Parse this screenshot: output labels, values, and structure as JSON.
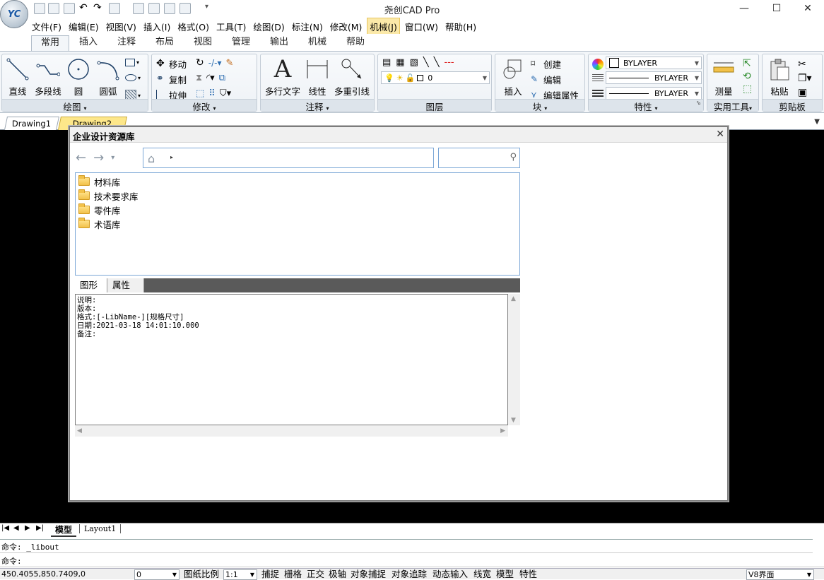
{
  "app": {
    "title": "尧创CAD Pro",
    "logo_text": "YC"
  },
  "menus": [
    "文件(F)",
    "编辑(E)",
    "视图(V)",
    "插入(I)",
    "格式(O)",
    "工具(T)",
    "绘图(D)",
    "标注(N)",
    "修改(M)",
    "机械(J)",
    "窗口(W)",
    "帮助(H)"
  ],
  "ribbon_tabs": [
    "常用",
    "插入",
    "注释",
    "布局",
    "视图",
    "管理",
    "输出",
    "机械",
    "帮助"
  ],
  "ribbon": {
    "draw": {
      "label": "绘图",
      "line": "直线",
      "polyline": "多段线",
      "circle": "圆",
      "arc": "圆弧"
    },
    "modify": {
      "label": "修改",
      "move": "移动",
      "copy": "复制",
      "stretch": "拉伸"
    },
    "annotate": {
      "label": "注释",
      "mtext": "多行文字",
      "linear": "线性",
      "mleader": "多重引线"
    },
    "layer": {
      "label": "图层",
      "current": "0"
    },
    "block": {
      "label": "块",
      "insert": "插入",
      "create": "创建",
      "edit": "编辑",
      "edit_attr": "编辑属性"
    },
    "props": {
      "label": "特性",
      "color": "BYLAYER",
      "linetype": "BYLAYER",
      "lineweight": "BYLAYER"
    },
    "utils": {
      "label": "实用工具",
      "measure": "测量"
    },
    "clipboard": {
      "label": "剪贴板",
      "paste": "粘贴"
    }
  },
  "doc_tabs": [
    "Drawing1",
    "Drawing2"
  ],
  "dialog": {
    "title": "企业设计资源库",
    "tree": [
      "材料库",
      "技术要求库",
      "零件库",
      "术语库"
    ],
    "tabs": [
      "图形",
      "属性"
    ],
    "info": [
      "说明:",
      "版本:",
      "格式:[-LibName-][规格尺寸]",
      "日期:2021-03-18 14:01:10.000",
      "备注:"
    ]
  },
  "layout_tabs": [
    "模型",
    "Layout1"
  ],
  "command": {
    "line1": "命令: _libout",
    "line2": "命令:"
  },
  "status": {
    "coords": "450.4055,850.7409,0",
    "layer_value": "0",
    "paper_scale_label": "图纸比例",
    "scale_value": "1:1",
    "toggles": [
      "捕捉",
      "栅格",
      "正交",
      "极轴",
      "对象捕捉",
      "对象追踪",
      "动态输入",
      "线宽",
      "模型",
      "特性"
    ],
    "ui_value": "V8界面"
  }
}
